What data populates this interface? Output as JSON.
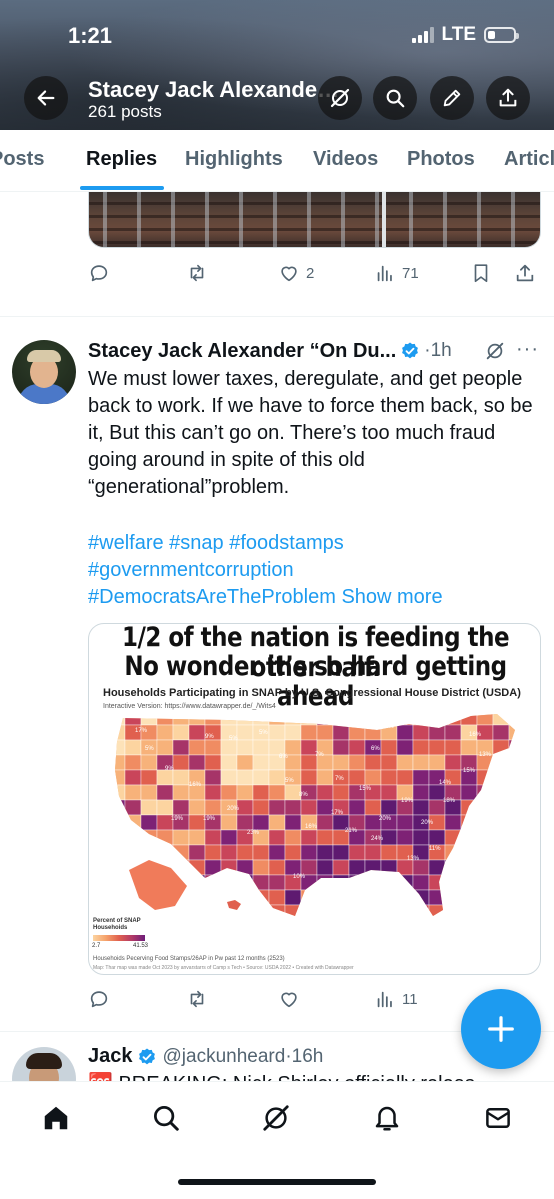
{
  "status_bar": {
    "time": "1:21",
    "network": "LTE",
    "battery_level": 0.3
  },
  "profile_header": {
    "name": "Stacey Jack Alexander “On Duty”",
    "post_count": "261 posts",
    "buttons": [
      "back-arrow-icon",
      "grok-icon",
      "search-icon",
      "pencil-icon",
      "share-icon"
    ]
  },
  "tabs": [
    {
      "label": "Posts",
      "active": false
    },
    {
      "label": "Replies",
      "active": true
    },
    {
      "label": "Highlights",
      "active": false
    },
    {
      "label": "Videos",
      "active": false
    },
    {
      "label": "Photos",
      "active": false
    },
    {
      "label": "Articles",
      "active": false
    }
  ],
  "previous_post": {
    "actions": {
      "replies": "",
      "reposts": "",
      "likes": "2",
      "views": "71"
    }
  },
  "post": {
    "author": "Stacey Jack Alexander “On Du...",
    "time": "·1h",
    "more": "···",
    "text": "We must lower taxes, deregulate, and get people back to work. If we have to force them back, so be it, But this can’t go on. There’s too much fraud going around in spite of this old “generational”problem.",
    "hashtags": [
      "#welfare",
      "#snap",
      "#foodstamps",
      "#governmentcorruption",
      "#DemocratsAreTheProblem"
    ],
    "show_more": "Show more",
    "image": {
      "headline_1": "1/2 of the nation is feeding the other half.",
      "headline_2": "No wonder it’s so hard getting ahead",
      "map_title": "Households Participating in SNAP by U.S. Congressional House District (USDA)",
      "map_subtitle": "Interactive Version: https://www.datawrapper.de/_/Wits4",
      "legend_title_1": "Percent of SNAP",
      "legend_title_2": "Househoids",
      "legend_min": "2.7",
      "legend_max": "41.53",
      "footnote_1": "Househoids Pecerving Food Stamps/26AP in Pw past 12 months (2523)",
      "footnote_2": "Map: Thar map was made Oct 2023 by anvarstarrs of Camp s Tech • Source: USDA 2022 • Created with Datawrapper",
      "district_labels": [
        "17%",
        "9%",
        "5%",
        "5%",
        "6%",
        "8%",
        "16%",
        "13%",
        "15%",
        "14%",
        "6%",
        "7%",
        "20%",
        "19%",
        "23%",
        "17%",
        "16%",
        "24%",
        "21%",
        "20%",
        "19%",
        "18%",
        "10%",
        "13%",
        "11%",
        "9%",
        "7%",
        "5%",
        "5%",
        "8%",
        "15%",
        "20%",
        "19%",
        "16%"
      ],
      "colors": {
        "low": "#fcd4a0",
        "mid": "#e0604f",
        "high": "#6d1d7a"
      }
    },
    "actions": {
      "replies": "",
      "reposts": "",
      "likes": "",
      "views": "11"
    }
  },
  "next_post": {
    "author": "Jack",
    "handle": "@jackunheard",
    "time": "·16h",
    "text": "🆘 BREAKING: Nick Shirley officially releas"
  },
  "fab": {
    "icon": "plus-icon"
  },
  "bottom_nav": [
    "home-icon",
    "search-icon",
    "grok-icon",
    "bell-icon",
    "mail-icon"
  ],
  "theme": {
    "accent": "#1d9bf0",
    "text": "#0f1419",
    "muted": "#536471"
  }
}
